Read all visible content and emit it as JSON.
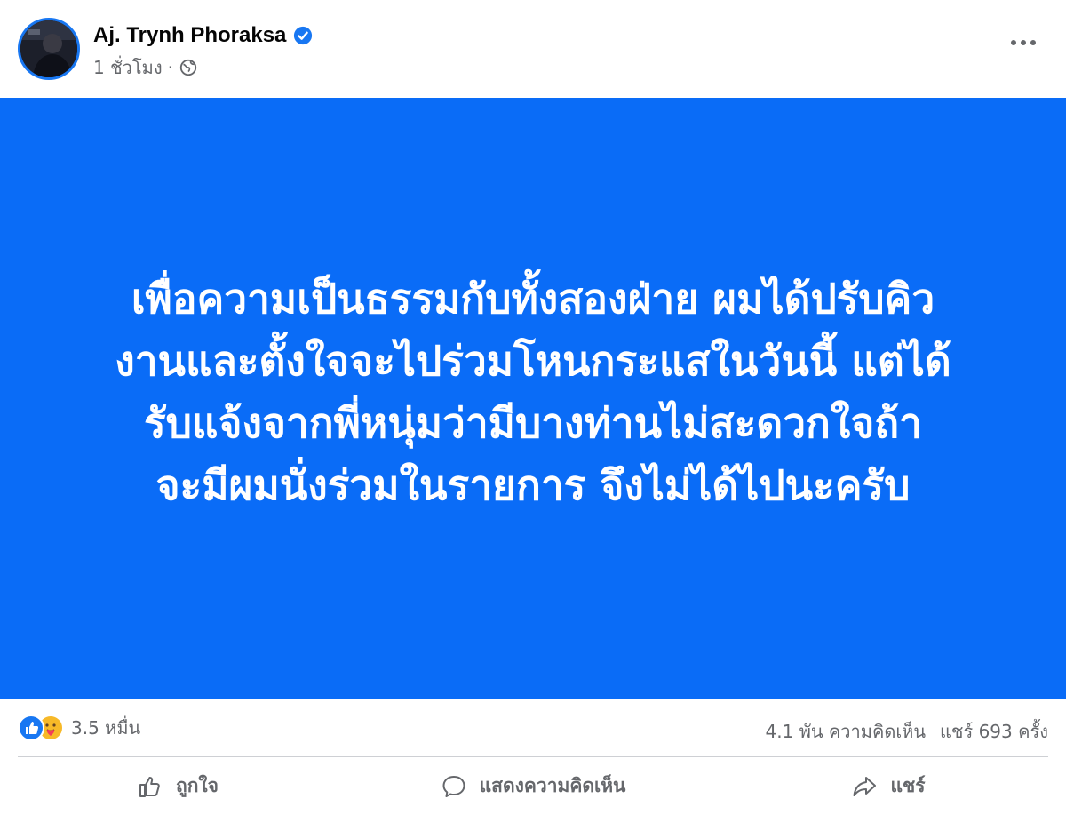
{
  "post": {
    "author": "Aj. Trynh Phoraksa",
    "time": "1 ชั่วโมง",
    "separator": "·",
    "text": "เพื่อความเป็นธรรมกับทั้งสองฝ่าย ผมได้ปรับคิว\nงานและตั้งใจจะไปร่วมโหนกระแสในวันนี้ แต่ได้\nรับแจ้งจากพี่หนุ่มว่ามีบางท่านไม่สะดวกใจถ้า\nจะมีผมนั่งร่วมในรายการ จึงไม่ได้ไปนะครับ",
    "background_color": "#0A6CF7"
  },
  "stats": {
    "reactions": "3.5 หมื่น",
    "comments": "4.1 พัน ความคิดเห็น",
    "shares": "แชร์ 693 ครั้ง"
  },
  "actions": {
    "like": "ถูกใจ",
    "comment": "แสดงความคิดเห็น",
    "share": "แชร์"
  },
  "icons": {
    "verified": "verified-badge-icon",
    "audience": "globe-icon",
    "more": "more-options-icon",
    "like_reaction": "like-reaction-icon",
    "care_reaction": "care-reaction-icon",
    "like_action": "thumbs-up-icon",
    "comment_action": "comment-bubble-icon",
    "share_action": "share-arrow-icon"
  },
  "colors": {
    "accent": "#1877F2",
    "secondary_text": "#65676B"
  }
}
